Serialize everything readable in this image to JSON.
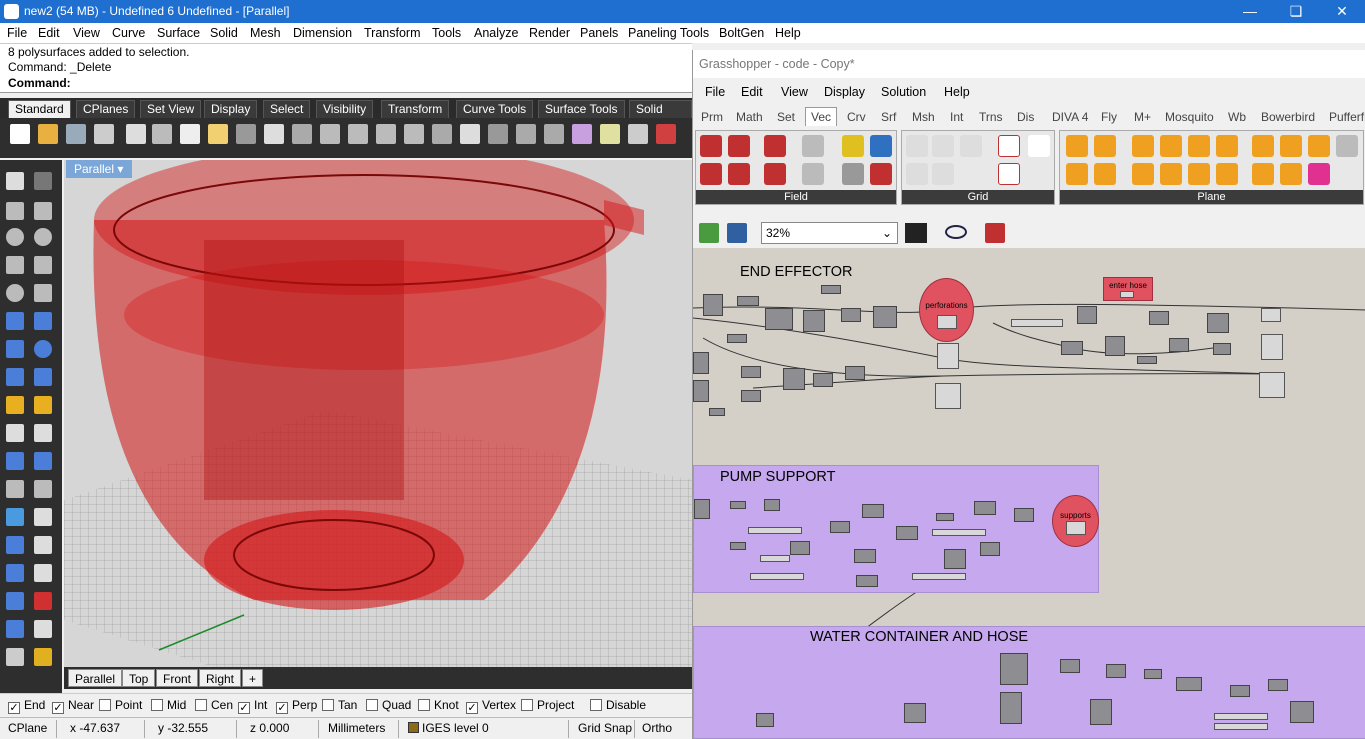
{
  "rhino": {
    "title": "new2 (54 MB) - Undefined 6 Undefined - [Parallel]",
    "menu": [
      "File",
      "Edit",
      "View",
      "Curve",
      "Surface",
      "Solid",
      "Mesh",
      "Dimension",
      "Transform",
      "Tools",
      "Analyze",
      "Render",
      "Panels",
      "Paneling Tools",
      "BoltGen",
      "Help"
    ],
    "history": [
      "8 polysurfaces added to selection.",
      "Command: _Delete"
    ],
    "prompt": "Command:",
    "tabs": [
      "Standard",
      "CPlanes",
      "Set View",
      "Display",
      "Select",
      "Visibility",
      "Transform",
      "Curve Tools",
      "Surface Tools",
      "Solid Tool"
    ],
    "viewport_name": "Parallel",
    "viewport_tabs": [
      "Parallel",
      "Top",
      "Front",
      "Right",
      "+"
    ],
    "osnaps": [
      {
        "label": "End",
        "checked": true
      },
      {
        "label": "Near",
        "checked": true
      },
      {
        "label": "Point",
        "checked": false
      },
      {
        "label": "Mid",
        "checked": false
      },
      {
        "label": "Cen",
        "checked": false
      },
      {
        "label": "Int",
        "checked": true
      },
      {
        "label": "Perp",
        "checked": true
      },
      {
        "label": "Tan",
        "checked": false
      },
      {
        "label": "Quad",
        "checked": false
      },
      {
        "label": "Knot",
        "checked": false
      },
      {
        "label": "Vertex",
        "checked": true
      },
      {
        "label": "Project",
        "checked": false
      },
      {
        "label": "Disable",
        "checked": false
      }
    ],
    "status": {
      "cplane": "CPlane",
      "x": "x -47.637",
      "y": "y -32.555",
      "z": "z 0.000",
      "units": "Millimeters",
      "layer": "IGES level 0",
      "gridsnap": "Grid Snap",
      "ortho": "Ortho"
    },
    "colors": {
      "object": "#d41414",
      "titlebar": "#1e6fd0"
    }
  },
  "gh": {
    "title": "Grasshopper - code - Copy*",
    "menu": [
      "File",
      "Edit",
      "View",
      "Display",
      "Solution",
      "Help"
    ],
    "tabs": [
      "Prm",
      "Math",
      "Set",
      "Vec",
      "Crv",
      "Srf",
      "Msh",
      "Int",
      "Trns",
      "Dis",
      "DIVA 4",
      "Fly",
      "M+",
      "Mosquito",
      "Wb",
      "Bowerbird",
      "Pufferfis"
    ],
    "active_tab": "Vec",
    "panels": [
      "Field",
      "Grid",
      "Plane"
    ],
    "zoom": "32%",
    "groups": [
      {
        "title": "END EFFECTOR",
        "color": "#d4d0c8"
      },
      {
        "title": "PUMP SUPPORT",
        "color": "#c5a8ee"
      },
      {
        "title": "WATER CONTAINER AND HOSE",
        "color": "#c5a8ee"
      }
    ],
    "labels": {
      "perforations": "perforations",
      "enter_hose": "enter hose",
      "supports": "supports"
    }
  }
}
